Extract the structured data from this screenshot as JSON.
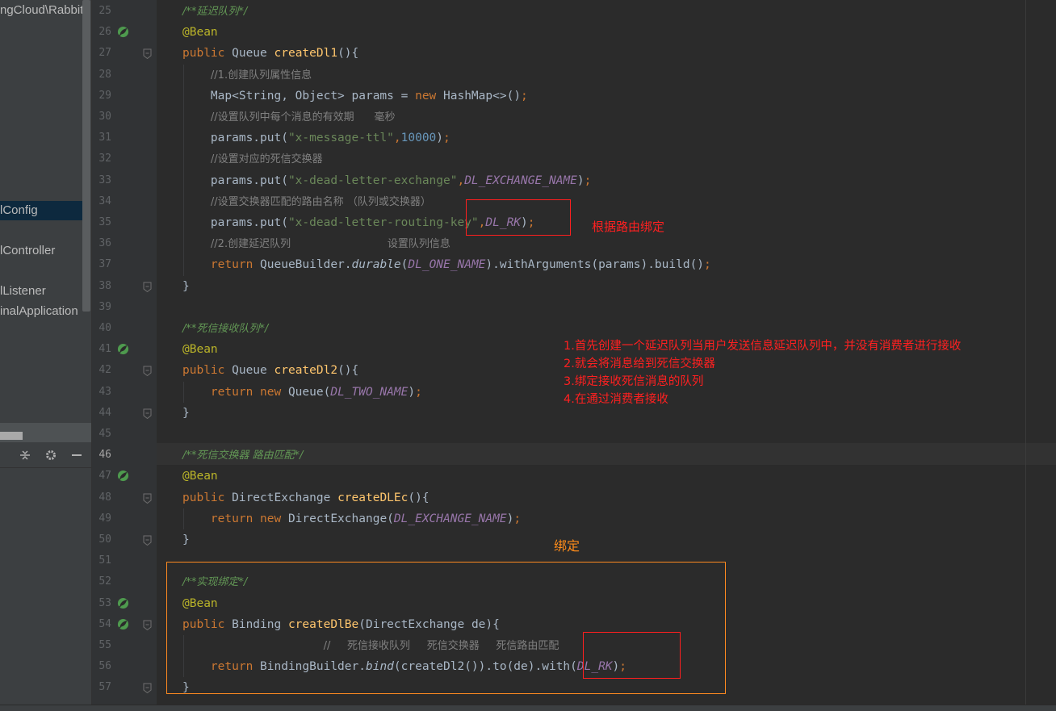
{
  "project_panel": {
    "items": [
      {
        "label": "ngCloud\\Rabbit",
        "selected": false
      },
      {
        "label": "lConfig",
        "selected": true
      },
      {
        "label": "lController",
        "selected": false
      },
      {
        "label": "lListener",
        "selected": false
      },
      {
        "label": "inalApplication",
        "selected": false
      }
    ],
    "toolbar_icons": [
      "collapse-all-icon",
      "gear-icon",
      "minimize-icon"
    ]
  },
  "editor": {
    "current_line": 46,
    "lines": [
      {
        "n": 25,
        "tokens": [
          {
            "t": "/**延迟队列*/",
            "c": "doc"
          }
        ]
      },
      {
        "n": 26,
        "tokens": [
          {
            "t": "@Bean",
            "c": "ann"
          }
        ]
      },
      {
        "n": 27,
        "tokens": [
          {
            "t": "public ",
            "c": "kw"
          },
          {
            "t": "Queue "
          },
          {
            "t": "createDl1",
            "c": "fn"
          },
          {
            "t": "(){"
          }
        ]
      },
      {
        "n": 28,
        "tokens": [
          {
            "t": "    "
          },
          {
            "t": "//1.创建队列属性信息",
            "c": "cmt"
          }
        ]
      },
      {
        "n": 29,
        "tokens": [
          {
            "t": "    Map<String, Object> params = "
          },
          {
            "t": "new ",
            "c": "kw"
          },
          {
            "t": "HashMap<>()"
          },
          {
            "t": ";",
            "c": "kw"
          }
        ]
      },
      {
        "n": 30,
        "tokens": [
          {
            "t": "    "
          },
          {
            "t": "//设置队列中每个消息的有效期      毫秒",
            "c": "cmt"
          }
        ]
      },
      {
        "n": 31,
        "tokens": [
          {
            "t": "    params.put("
          },
          {
            "t": "\"x-message-ttl\"",
            "c": "str"
          },
          {
            "t": ",",
            "c": "kw"
          },
          {
            "t": "10000",
            "c": "num"
          },
          {
            "t": ")"
          },
          {
            "t": ";",
            "c": "kw"
          }
        ]
      },
      {
        "n": 32,
        "tokens": [
          {
            "t": "    "
          },
          {
            "t": "//设置对应的死信交换器",
            "c": "cmt"
          }
        ]
      },
      {
        "n": 33,
        "tokens": [
          {
            "t": "    params.put("
          },
          {
            "t": "\"x-dead-letter-exchange\"",
            "c": "str"
          },
          {
            "t": ",",
            "c": "kw"
          },
          {
            "t": "DL_EXCHANGE_NAME",
            "c": "const"
          },
          {
            "t": ")"
          },
          {
            "t": ";",
            "c": "kw"
          }
        ]
      },
      {
        "n": 34,
        "tokens": [
          {
            "t": "    "
          },
          {
            "t": "//设置交换器匹配的路由名称 （队列或交换器）",
            "c": "cmt"
          }
        ]
      },
      {
        "n": 35,
        "tokens": [
          {
            "t": "    params.put("
          },
          {
            "t": "\"x-dead-letter-routing-key\"",
            "c": "str"
          },
          {
            "t": ",",
            "c": "kw"
          },
          {
            "t": "DL_RK",
            "c": "const"
          },
          {
            "t": ")"
          },
          {
            "t": ";",
            "c": "kw"
          }
        ]
      },
      {
        "n": 36,
        "tokens": [
          {
            "t": "    "
          },
          {
            "t": "//2.创建延迟队列                             设置队列信息",
            "c": "cmt"
          }
        ]
      },
      {
        "n": 37,
        "tokens": [
          {
            "t": "    "
          },
          {
            "t": "return ",
            "c": "kw"
          },
          {
            "t": "QueueBuilder."
          },
          {
            "t": "durable",
            "c": "static"
          },
          {
            "t": "("
          },
          {
            "t": "DL_ONE_NAME",
            "c": "const"
          },
          {
            "t": ").withArguments(params).build()"
          },
          {
            "t": ";",
            "c": "kw"
          }
        ]
      },
      {
        "n": 38,
        "tokens": [
          {
            "t": "}"
          }
        ]
      },
      {
        "n": 39,
        "tokens": []
      },
      {
        "n": 40,
        "tokens": [
          {
            "t": "/**死信接收队列*/",
            "c": "doc"
          }
        ]
      },
      {
        "n": 41,
        "tokens": [
          {
            "t": "@Bean",
            "c": "ann"
          }
        ]
      },
      {
        "n": 42,
        "tokens": [
          {
            "t": "public ",
            "c": "kw"
          },
          {
            "t": "Queue "
          },
          {
            "t": "createDl2",
            "c": "fn"
          },
          {
            "t": "(){"
          }
        ]
      },
      {
        "n": 43,
        "tokens": [
          {
            "t": "    "
          },
          {
            "t": "return new ",
            "c": "kw"
          },
          {
            "t": "Queue("
          },
          {
            "t": "DL_TWO_NAME",
            "c": "const"
          },
          {
            "t": ")"
          },
          {
            "t": ";",
            "c": "kw"
          }
        ]
      },
      {
        "n": 44,
        "tokens": [
          {
            "t": "}"
          }
        ]
      },
      {
        "n": 45,
        "tokens": []
      },
      {
        "n": 46,
        "tokens": [
          {
            "t": "/**死信交换器 路由匹配*/",
            "c": "doc"
          }
        ]
      },
      {
        "n": 47,
        "tokens": [
          {
            "t": "@Bean",
            "c": "ann"
          }
        ]
      },
      {
        "n": 48,
        "tokens": [
          {
            "t": "public ",
            "c": "kw"
          },
          {
            "t": "DirectExchange "
          },
          {
            "t": "createDLEc",
            "c": "fn"
          },
          {
            "t": "(){"
          }
        ]
      },
      {
        "n": 49,
        "tokens": [
          {
            "t": "    "
          },
          {
            "t": "return new ",
            "c": "kw"
          },
          {
            "t": "DirectExchange("
          },
          {
            "t": "DL_EXCHANGE_NAME",
            "c": "const"
          },
          {
            "t": ")"
          },
          {
            "t": ";",
            "c": "kw"
          }
        ]
      },
      {
        "n": 50,
        "tokens": [
          {
            "t": "}"
          }
        ]
      },
      {
        "n": 51,
        "tokens": []
      },
      {
        "n": 52,
        "tokens": [
          {
            "t": "/**实现绑定*/",
            "c": "doc"
          }
        ]
      },
      {
        "n": 53,
        "tokens": [
          {
            "t": "@Bean",
            "c": "ann"
          }
        ]
      },
      {
        "n": 54,
        "tokens": [
          {
            "t": "public ",
            "c": "kw"
          },
          {
            "t": "Binding "
          },
          {
            "t": "createDlBe",
            "c": "fn"
          },
          {
            "t": "(DirectExchange de){"
          }
        ]
      },
      {
        "n": 55,
        "tokens": [
          {
            "t": "                    "
          },
          {
            "t": "//     死信接收队列     死信交换器     死信路由匹配",
            "c": "cmt"
          }
        ]
      },
      {
        "n": 56,
        "tokens": [
          {
            "t": "    "
          },
          {
            "t": "return ",
            "c": "kw"
          },
          {
            "t": "BindingBuilder."
          },
          {
            "t": "bind",
            "c": "static"
          },
          {
            "t": "(createDl2()).to(de).with("
          },
          {
            "t": "DL_RK",
            "c": "const"
          },
          {
            "t": ")"
          },
          {
            "t": ";",
            "c": "kw"
          }
        ]
      },
      {
        "n": 57,
        "tokens": [
          {
            "t": "}"
          }
        ]
      }
    ],
    "bean_lines": [
      26,
      41,
      47,
      53,
      54
    ],
    "fold_lines": [
      27,
      38,
      42,
      44,
      48,
      50,
      54,
      57
    ]
  },
  "annotations": {
    "routing_bind_note": "根据路由绑定",
    "steps": [
      "1.首先创建一个延迟队列当用户发送信息延迟队列中，并没有消费者进行接收",
      "2.就会将消息给到死信交换器",
      "3.绑定接收死信消息的队列",
      "4.在通过消费者接收"
    ],
    "bind_label": "绑定",
    "colors": {
      "red": "#ff2020",
      "orange": "#ff8c1a"
    }
  },
  "theme": {
    "editor_bg": "#2b2b2b",
    "gutter_bg": "#313335",
    "panel_bg": "#3c3f41",
    "keyword": "#cc7832",
    "string": "#6a8759",
    "number": "#6897bb",
    "function": "#ffc66d",
    "annotation": "#bbb529",
    "constant": "#9876aa",
    "comment": "#808080",
    "doc_comment": "#629755"
  }
}
